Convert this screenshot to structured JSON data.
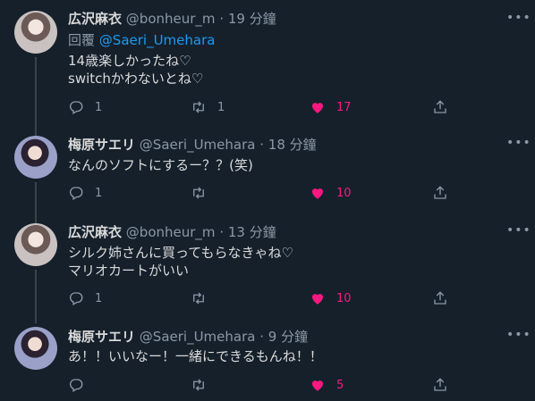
{
  "tweets": [
    {
      "name": "広沢麻衣",
      "handle": "@bonheur_m",
      "dot": "·",
      "time": "19 分鐘",
      "reply_prefix": "回覆",
      "reply_to": "@Saeri_Umehara",
      "lines": [
        "14歳楽しかったね♡",
        "switchかわないとね♡"
      ],
      "replies": "1",
      "retweets": "1",
      "likes": "17"
    },
    {
      "name": "梅原サエリ",
      "handle": "@Saeri_Umehara",
      "dot": "·",
      "time": "18 分鐘",
      "lines": [
        "なんのソフトにするー？？(笑)"
      ],
      "replies": "1",
      "retweets": "",
      "likes": "10"
    },
    {
      "name": "広沢麻衣",
      "handle": "@bonheur_m",
      "dot": "·",
      "time": "13 分鐘",
      "lines": [
        "シルク姉さんに買ってもらなきゃね♡",
        "マリオカートがいい"
      ],
      "replies": "1",
      "retweets": "",
      "likes": "10"
    },
    {
      "name": "梅原サエリ",
      "handle": "@Saeri_Umehara",
      "dot": "·",
      "time": "9 分鐘",
      "lines": [
        "あ！！いいなー！一緒にできるもんね！！"
      ],
      "replies": "",
      "retweets": "",
      "likes": "5"
    }
  ],
  "icons": {
    "reply": "reply-icon",
    "retweet": "retweet-icon",
    "like": "heart-icon",
    "share": "share-icon",
    "more": "more-icon"
  },
  "colors": {
    "background": "#15202b",
    "text": "#d9d9d9",
    "muted": "#8b98a5",
    "mention": "#1d9bf0",
    "like": "#f91880"
  }
}
